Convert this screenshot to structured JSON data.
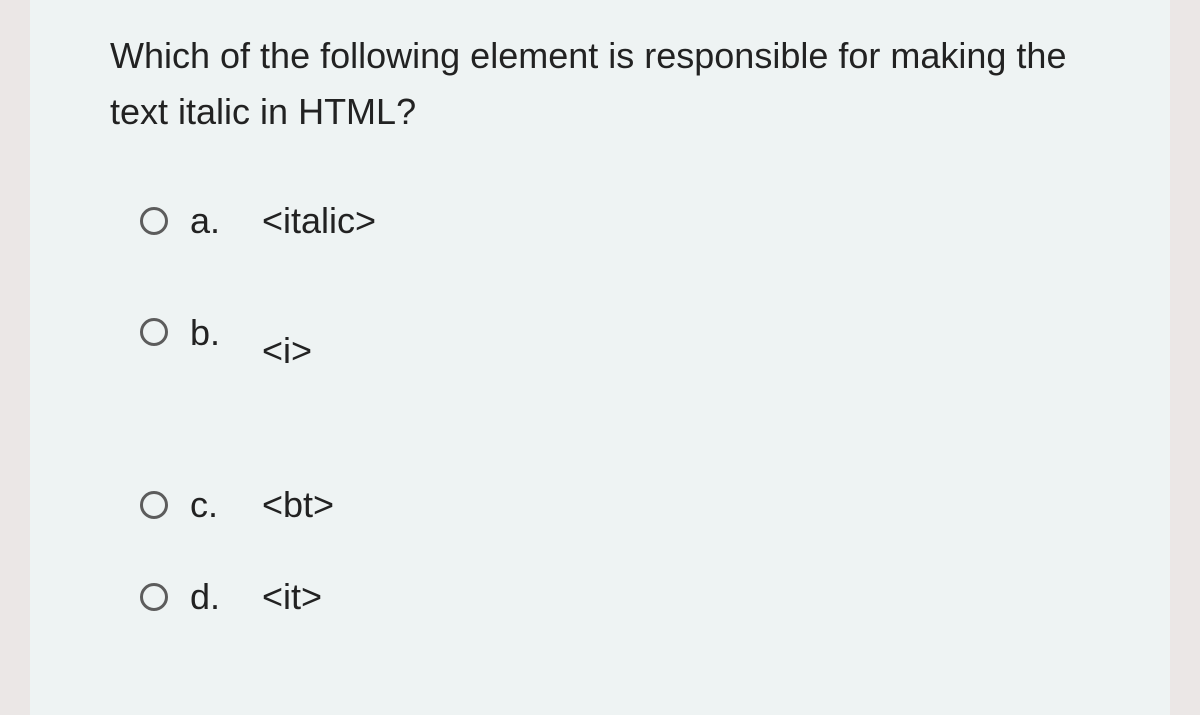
{
  "question": "Which of the following element is responsible for making the text italic in HTML?",
  "options": [
    {
      "letter": "a.",
      "text": "<italic>"
    },
    {
      "letter": "b.",
      "text": "<i>"
    },
    {
      "letter": "c.",
      "text": "<bt>"
    },
    {
      "letter": "d.",
      "text": "<it>"
    }
  ]
}
